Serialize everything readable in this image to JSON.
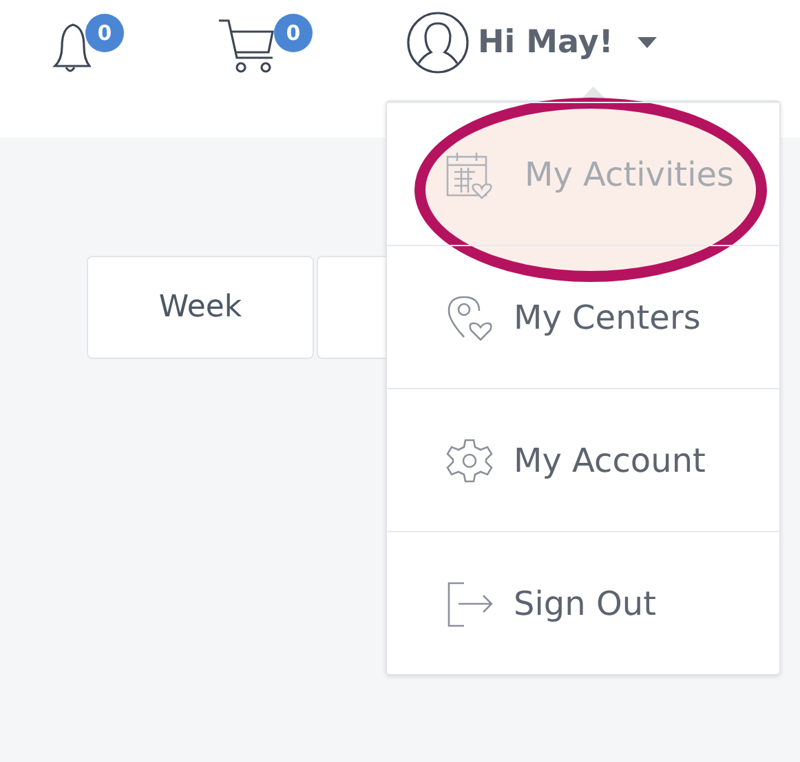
{
  "header": {
    "notifications": {
      "count": "0"
    },
    "cart": {
      "count": "0"
    },
    "user": {
      "greeting": "Hi May!"
    }
  },
  "view_buttons": [
    {
      "kind": "labeled",
      "label": "Week"
    },
    {
      "kind": "covered"
    }
  ],
  "menu": {
    "items": [
      {
        "kind": "activities",
        "label": "My Activities",
        "highlighted": true
      },
      {
        "kind": "centers",
        "label": "My Centers",
        "highlighted": false
      },
      {
        "kind": "account",
        "label": "My Account",
        "highlighted": false
      },
      {
        "kind": "signout",
        "label": "Sign Out",
        "highlighted": false
      }
    ]
  }
}
